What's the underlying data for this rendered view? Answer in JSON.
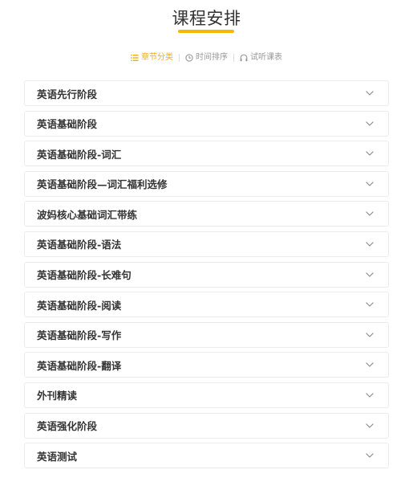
{
  "page": {
    "title": "课程安排"
  },
  "tabs": [
    {
      "label": "章节分类",
      "icon": "list-icon",
      "active": true
    },
    {
      "label": "时间排序",
      "icon": "clock-icon",
      "active": false
    },
    {
      "label": "试听课表",
      "icon": "headphones-icon",
      "active": false
    }
  ],
  "colors": {
    "accent": "#f5b800",
    "active_tab": "#f0ad1a",
    "muted": "#999999",
    "border": "#ececec"
  },
  "sections": [
    {
      "label": "英语先行阶段"
    },
    {
      "label": "英语基础阶段"
    },
    {
      "label": "英语基础阶段-词汇"
    },
    {
      "label": "英语基础阶段—词汇福利选修"
    },
    {
      "label": "波妈核心基础词汇带练"
    },
    {
      "label": "英语基础阶段-语法"
    },
    {
      "label": "英语基础阶段-长难句"
    },
    {
      "label": "英语基础阶段-阅读"
    },
    {
      "label": "英语基础阶段-写作"
    },
    {
      "label": "英语基础阶段-翻译"
    },
    {
      "label": "外刊精读"
    },
    {
      "label": "英语强化阶段"
    },
    {
      "label": "英语测试"
    }
  ]
}
